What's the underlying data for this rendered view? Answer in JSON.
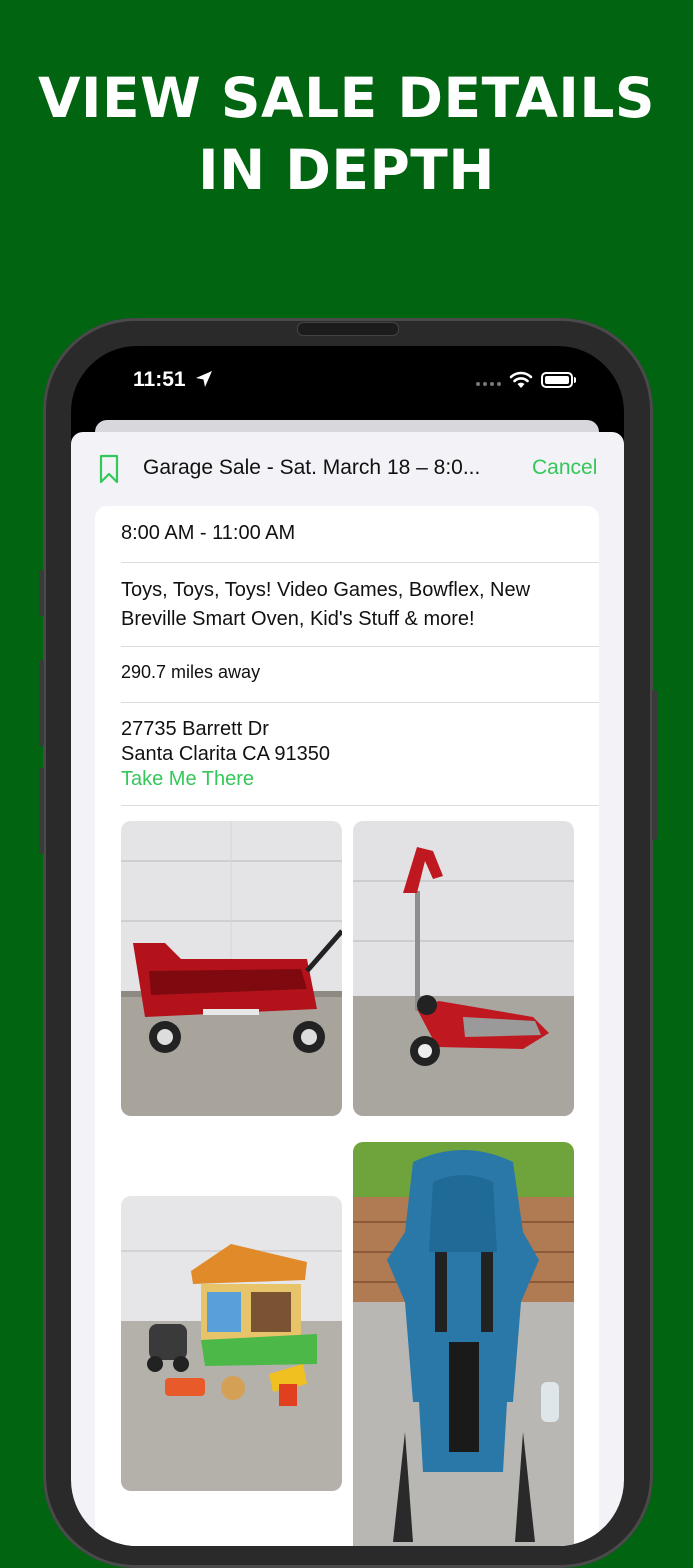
{
  "promo": {
    "line1": "VIEW SALE DETAILS",
    "line2": "IN DEPTH"
  },
  "status_bar": {
    "time": "11:51",
    "icons": [
      "location-arrow-icon",
      "signal-icon",
      "wifi-icon",
      "battery-icon"
    ]
  },
  "sheet": {
    "title": "Garage Sale - Sat. March 18 – 8:0...",
    "cancel_label": "Cancel",
    "bookmark_icon": "bookmark-icon"
  },
  "sale": {
    "hours": "8:00 AM - 11:00 AM",
    "description": "Toys, Toys, Toys! Video Games, Bowflex, New Breville Smart Oven, Kid's Stuff & more!",
    "distance": "290.7 miles away",
    "address_line1": "27735 Barrett Dr",
    "address_line2": "Santa Clarita CA 91350",
    "directions_label": "Take Me There"
  },
  "photos": [
    {
      "subject": "red wagon"
    },
    {
      "subject": "red scooter"
    },
    {
      "subject": "toy playset"
    },
    {
      "subject": "blue child carrier backpack"
    }
  ],
  "colors": {
    "background": "#006410",
    "accent": "#34c759"
  }
}
